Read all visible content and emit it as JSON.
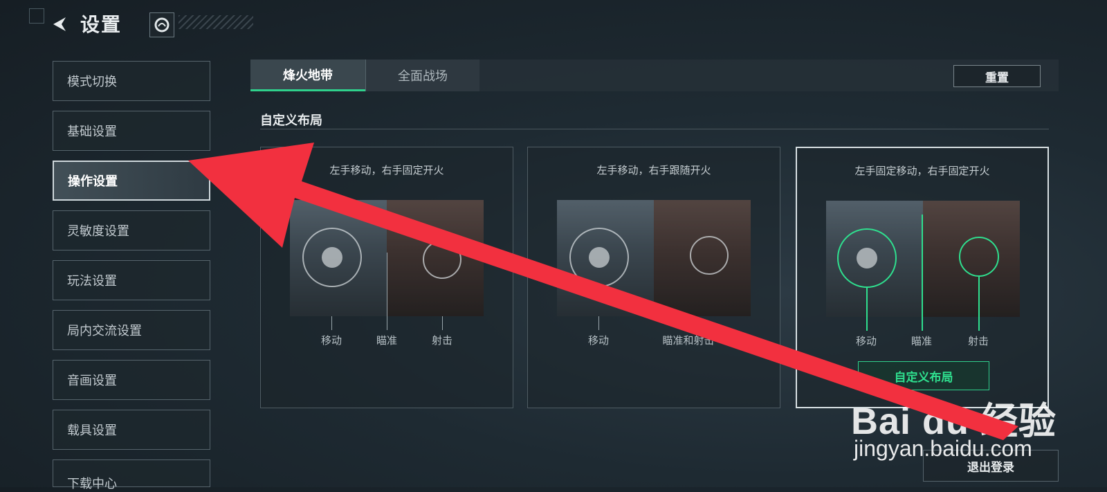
{
  "header": {
    "title": "设置",
    "back_icon": "back-arrow-icon",
    "game_icon": "game-logo-icon"
  },
  "sidebar": {
    "items": [
      {
        "label": "模式切换"
      },
      {
        "label": "基础设置"
      },
      {
        "label": "操作设置",
        "active": true
      },
      {
        "label": "灵敏度设置"
      },
      {
        "label": "玩法设置"
      },
      {
        "label": "局内交流设置"
      },
      {
        "label": "音画设置"
      },
      {
        "label": "载具设置"
      },
      {
        "label": "下载中心"
      }
    ]
  },
  "tabs": [
    {
      "label": "烽火地带",
      "active": true
    },
    {
      "label": "全面战场"
    }
  ],
  "reset_label": "重置",
  "section_title": "自定义布局",
  "cards": [
    {
      "title": "左手移动，右手固定开火",
      "labels": [
        "移动",
        "瞄准",
        "射击"
      ],
      "selected": false
    },
    {
      "title": "左手移动，右手跟随开火",
      "labels": [
        "移动",
        "瞄准和射击"
      ],
      "selected": false
    },
    {
      "title": "左手固定移动，右手固定开火",
      "labels": [
        "移动",
        "瞄准",
        "射击"
      ],
      "selected": true
    }
  ],
  "custom_layout_label": "自定义布局",
  "logout_label": "退出登录",
  "watermark": {
    "brand": "Bai du 经验",
    "url": "jingyan.baidu.com"
  },
  "colors": {
    "accent_green": "#2fd18c",
    "annotation_arrow": "#f2303f"
  }
}
